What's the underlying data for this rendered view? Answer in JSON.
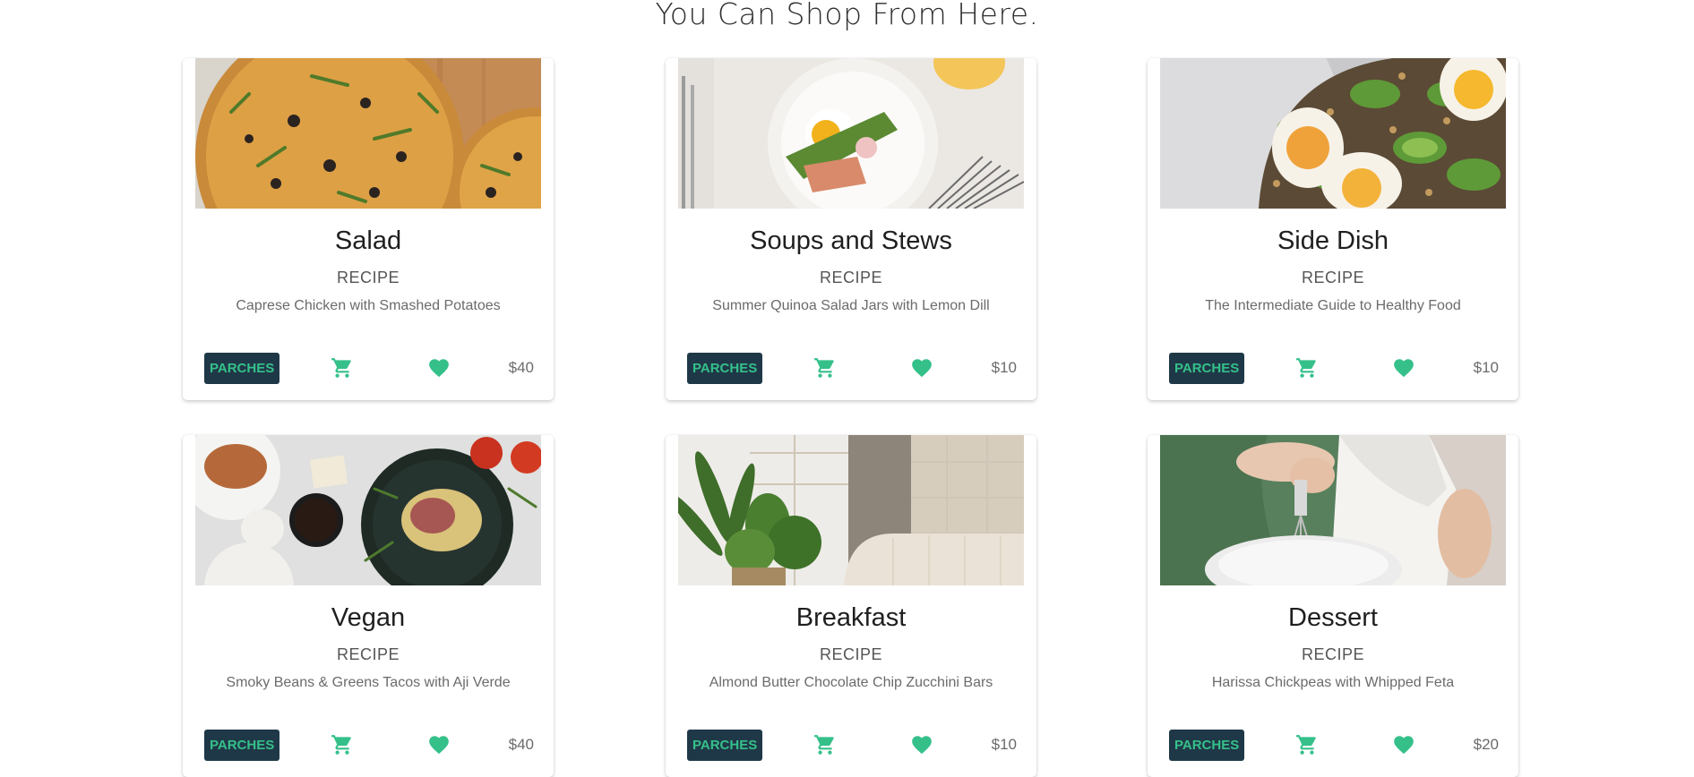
{
  "header": {
    "title": "You Can Shop From Here."
  },
  "colors": {
    "accent": "#35c08a",
    "button_bg": "#1f3847"
  },
  "icons": {
    "cart": "shopping-cart-icon",
    "heart": "heart-icon"
  },
  "cards": [
    {
      "title": "Salad",
      "type": "RECIPE",
      "description": "Caprese Chicken with Smashed Potatoes",
      "button_label": "PARCHES",
      "price": "$40",
      "image": "pizza"
    },
    {
      "title": "Soups and Stews",
      "type": "RECIPE",
      "description": "Summer Quinoa Salad Jars with Lemon Dill",
      "button_label": "PARCHES",
      "price": "$10",
      "image": "egg-plate"
    },
    {
      "title": "Side Dish",
      "type": "RECIPE",
      "description": "The Intermediate Guide to Healthy Food",
      "button_label": "PARCHES",
      "price": "$10",
      "image": "avocado-egg-toast"
    },
    {
      "title": "Vegan",
      "type": "RECIPE",
      "description": "Smoky Beans & Greens Tacos with Aji Verde",
      "button_label": "PARCHES",
      "price": "$40",
      "image": "dinner-table"
    },
    {
      "title": "Breakfast",
      "type": "RECIPE",
      "description": "Almond Butter Chocolate Chip Zucchini Bars",
      "button_label": "PARCHES",
      "price": "$10",
      "image": "living-room-plants"
    },
    {
      "title": "Dessert",
      "type": "RECIPE",
      "description": "Harissa Chickpeas with Whipped Feta",
      "button_label": "PARCHES",
      "price": "$20",
      "image": "whisking-bowl"
    }
  ]
}
